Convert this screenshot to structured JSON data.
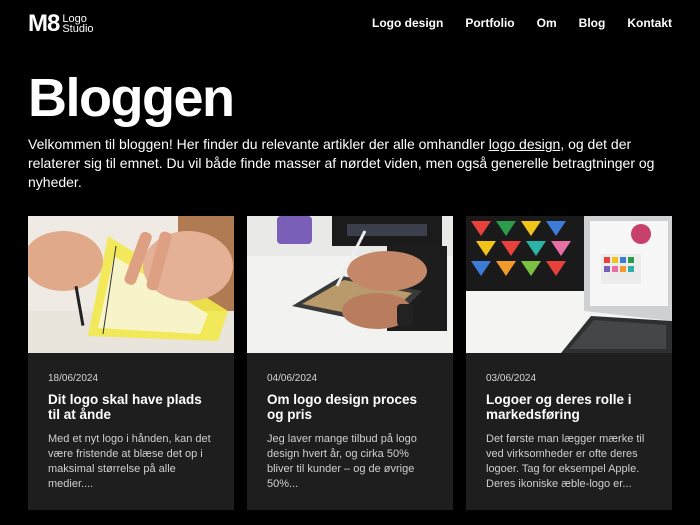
{
  "header": {
    "logo_mark": "M8",
    "logo_line1": "Logo",
    "logo_line2": "Studio",
    "nav": [
      "Logo design",
      "Portfolio",
      "Om",
      "Blog",
      "Kontakt"
    ]
  },
  "page": {
    "title": "Bloggen",
    "intro_part1": "Velkommen til bloggen! Her finder du relevante artikler der alle omhandler ",
    "intro_link": "logo design",
    "intro_part2": ", og det der relaterer sig til emnet. Du vil både finde masser af nørdet viden, men også generelle betragtninger og nyheder."
  },
  "posts": [
    {
      "date": "18/06/2024",
      "title": "Dit logo skal have plads til at ånde",
      "excerpt": "Med et nyt logo i hånden, kan det være fristende at blæse det op i maksimal størrelse på alle medier...."
    },
    {
      "date": "04/06/2024",
      "title": "Om logo design proces og pris",
      "excerpt": "Jeg laver mange tilbud på logo design hvert år, og cirka 50% bliver til kunder – og de øvrige 50%..."
    },
    {
      "date": "03/06/2024",
      "title": "Logoer og deres rolle i markedsføring",
      "excerpt": "Det første man lægger mærke til ved virksomheder er ofte deres logoer. Tag for eksempel Apple. Deres ikoniske æble-logo er..."
    }
  ]
}
